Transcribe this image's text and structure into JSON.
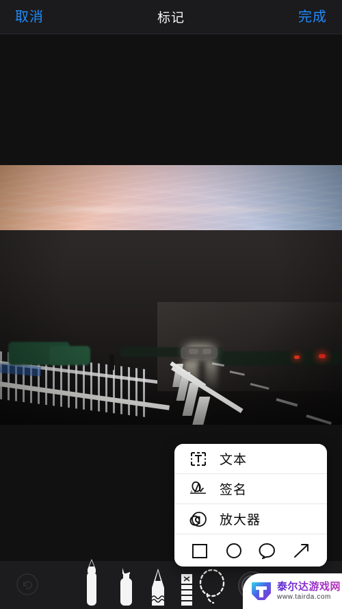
{
  "navbar": {
    "cancel_label": "取消",
    "title": "标记",
    "done_label": "完成"
  },
  "photo": {
    "alt": "城市日落街景照片",
    "description": "傍晚城市道路，粉橙色晚霞天空，街灯、树木、白色护栏与车流"
  },
  "menu": {
    "items": [
      {
        "icon": "text-box-icon",
        "label": "文本"
      },
      {
        "icon": "signature-icon",
        "label": "签名"
      },
      {
        "icon": "magnifier-icon",
        "label": "放大器"
      }
    ],
    "shapes": [
      {
        "icon": "square-shape-icon",
        "label": "矩形"
      },
      {
        "icon": "circle-shape-icon",
        "label": "圆形"
      },
      {
        "icon": "speech-bubble-shape-icon",
        "label": "对话气泡"
      },
      {
        "icon": "arrow-shape-icon",
        "label": "箭头"
      }
    ]
  },
  "toolbar": {
    "undo": {
      "icon": "undo-icon",
      "label": "撤销",
      "enabled": false
    },
    "tools": [
      {
        "icon": "pen-tool-icon",
        "label": "钢笔",
        "selected": true
      },
      {
        "icon": "marker-tool-icon",
        "label": "马克笔",
        "selected": false
      },
      {
        "icon": "pencil-tool-icon",
        "label": "铅笔",
        "selected": false
      },
      {
        "icon": "eraser-tool-icon",
        "label": "橡皮擦",
        "selected": false
      },
      {
        "icon": "lasso-tool-icon",
        "label": "套索",
        "selected": false
      }
    ],
    "color_picker": {
      "icon": "color-picker-icon",
      "label": "颜色",
      "color": "#000000"
    }
  },
  "watermark": {
    "logo": "tairda-shield-logo",
    "site_name": "泰尔达游戏网",
    "url": "www.tairda.com"
  },
  "colors": {
    "accent_blue": "#1f8bff",
    "nav_background": "#1b1b1d",
    "canvas_background": "#111112",
    "toolbar_background": "#1c1c1e",
    "menu_background": "#ffffff",
    "menu_text": "#0a0a0a"
  }
}
